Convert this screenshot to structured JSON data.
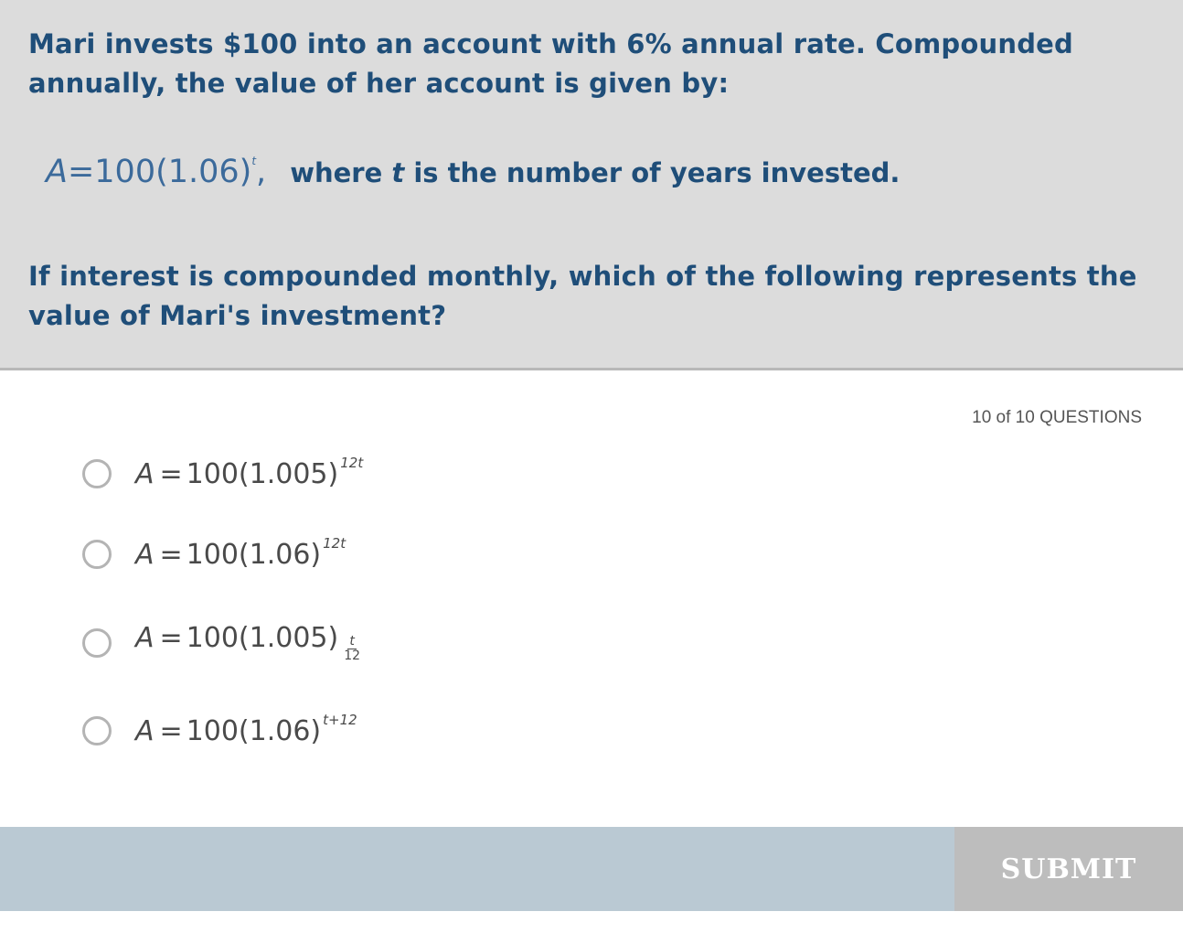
{
  "question": {
    "intro": "Mari invests $100 into an account with 6% annual rate. Compounded annually, the value of her account is given by:",
    "formula": {
      "var": "A",
      "eq": "=",
      "body": "100(1.06)",
      "exponent": "t",
      "trail": ",",
      "where_prefix": "where ",
      "where_var": "t",
      "where_suffix": " is the number of years invested."
    },
    "ask": "If interest is compounded monthly, which of the following represents the value of Mari's investment?"
  },
  "counter": "10 of 10 QUESTIONS",
  "choices": [
    {
      "var": "A",
      "eq": "=",
      "body": "100(1.005)",
      "exponent": "12t"
    },
    {
      "var": "A",
      "eq": "=",
      "body": "100(1.06)",
      "exponent": "12t"
    },
    {
      "var": "A",
      "eq": "=",
      "body": "100(1.005)",
      "frac_num": "t",
      "frac_den": "12"
    },
    {
      "var": "A",
      "eq": "=",
      "body": "100(1.06)",
      "exponent": "t+12"
    }
  ],
  "footer": {
    "submit_label": "SUBMIT"
  },
  "colors": {
    "question_text": "#1f4e79",
    "panel_bg": "#dcdcdc",
    "footer_bg": "#bac9d3",
    "submit_bg": "#bdbdbd"
  }
}
